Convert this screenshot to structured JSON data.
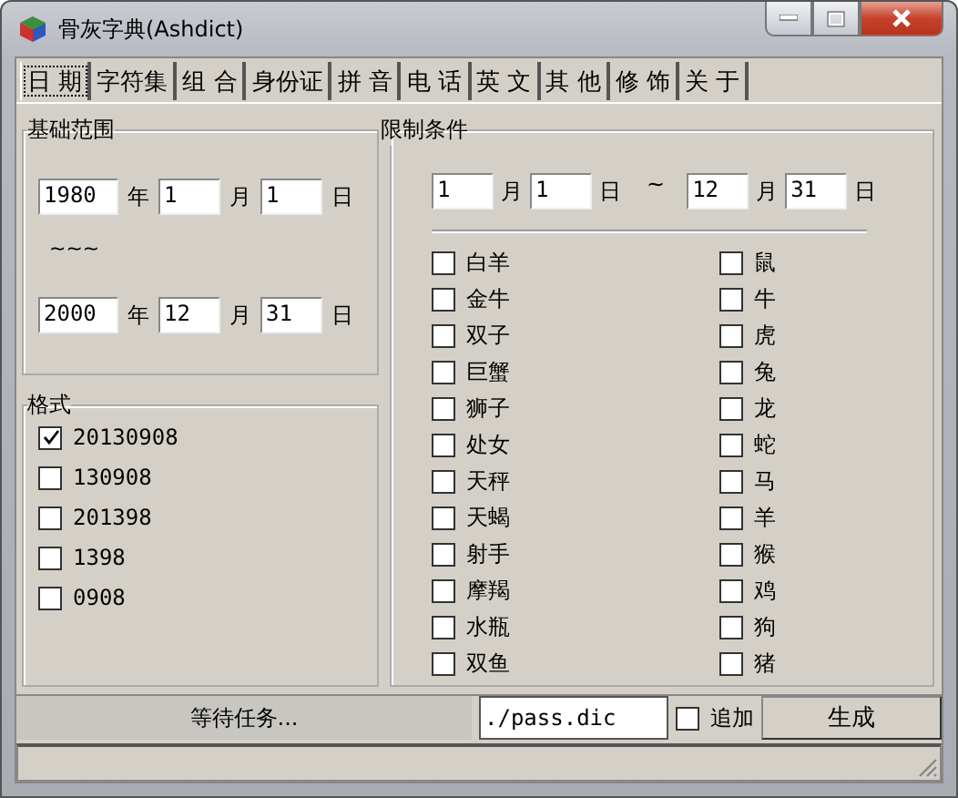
{
  "window": {
    "title": "骨灰字典(Ashdict)"
  },
  "tabs": [
    {
      "label": "日 期",
      "selected": true
    },
    {
      "label": "字符集",
      "selected": false
    },
    {
      "label": "组 合",
      "selected": false
    },
    {
      "label": "身份证",
      "selected": false
    },
    {
      "label": "拼 音",
      "selected": false
    },
    {
      "label": "电 话",
      "selected": false
    },
    {
      "label": "英 文",
      "selected": false
    },
    {
      "label": "其 他",
      "selected": false
    },
    {
      "label": "修 饰",
      "selected": false
    },
    {
      "label": "关 于",
      "selected": false
    }
  ],
  "base_range": {
    "title": "基础范围",
    "start": [
      {
        "value": "1980",
        "unit": "年"
      },
      {
        "value": "1",
        "unit": "月"
      },
      {
        "value": "1",
        "unit": "日"
      }
    ],
    "separator": "~~~",
    "end": [
      {
        "value": "2000",
        "unit": "年"
      },
      {
        "value": "12",
        "unit": "月"
      },
      {
        "value": "31",
        "unit": "日"
      }
    ]
  },
  "format": {
    "title": "格式",
    "options": [
      {
        "label": "20130908",
        "checked": true
      },
      {
        "label": "130908",
        "checked": false
      },
      {
        "label": "201398",
        "checked": false
      },
      {
        "label": "1398",
        "checked": false
      },
      {
        "label": "0908",
        "checked": false
      }
    ]
  },
  "limits": {
    "title": "限制条件",
    "from": [
      {
        "value": "1",
        "unit": "月"
      },
      {
        "value": "1",
        "unit": "日"
      }
    ],
    "separator": "~",
    "to": [
      {
        "value": "12",
        "unit": "月"
      },
      {
        "value": "31",
        "unit": "日"
      }
    ],
    "zodiac_signs": [
      {
        "label": "白羊",
        "checked": false
      },
      {
        "label": "金牛",
        "checked": false
      },
      {
        "label": "双子",
        "checked": false
      },
      {
        "label": "巨蟹",
        "checked": false
      },
      {
        "label": "狮子",
        "checked": false
      },
      {
        "label": "处女",
        "checked": false
      },
      {
        "label": "天秤",
        "checked": false
      },
      {
        "label": "天蝎",
        "checked": false
      },
      {
        "label": "射手",
        "checked": false
      },
      {
        "label": "摩羯",
        "checked": false
      },
      {
        "label": "水瓶",
        "checked": false
      },
      {
        "label": "双鱼",
        "checked": false
      }
    ],
    "chinese_zodiac": [
      {
        "label": "鼠",
        "checked": false
      },
      {
        "label": "牛",
        "checked": false
      },
      {
        "label": "虎",
        "checked": false
      },
      {
        "label": "兔",
        "checked": false
      },
      {
        "label": "龙",
        "checked": false
      },
      {
        "label": "蛇",
        "checked": false
      },
      {
        "label": "马",
        "checked": false
      },
      {
        "label": "羊",
        "checked": false
      },
      {
        "label": "猴",
        "checked": false
      },
      {
        "label": "鸡",
        "checked": false
      },
      {
        "label": "狗",
        "checked": false
      },
      {
        "label": "猪",
        "checked": false
      }
    ]
  },
  "bottom": {
    "status": "等待任务...",
    "output_file": "./pass.dic",
    "append": {
      "label": "追加",
      "checked": false
    },
    "generate_button": "生成"
  }
}
